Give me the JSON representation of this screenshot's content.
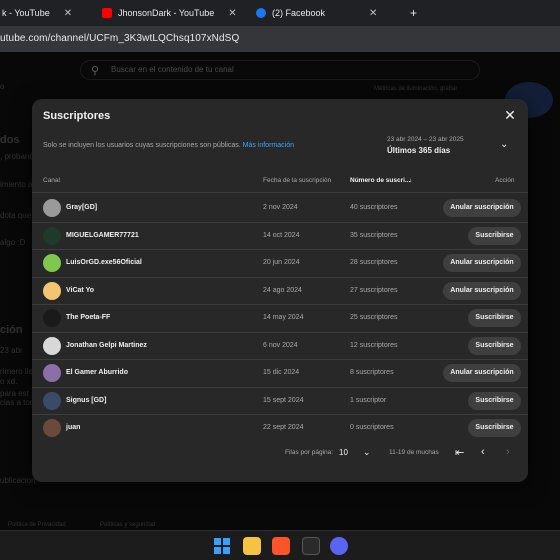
{
  "browser": {
    "tabs": [
      {
        "title": "k - YouTube"
      },
      {
        "title": "JhonsonDark - YouTube"
      },
      {
        "title": "(2) Facebook"
      }
    ],
    "new_tab": "+",
    "url": "utube.com/channel/UCFm_3K3wtLQChsq107xNdSQ"
  },
  "youtube": {
    "search_placeholder": "Buscar en el contenido de tu canal",
    "bg_texts": {
      "left1": "o",
      "left2": "dos",
      "left3": ", probando",
      "left4": "imiento a",
      "left5": "dota que",
      "left6": "algo :D",
      "left7": "ción",
      "left8": "23 abr",
      "left9": "rimero lleg",
      "left10": "o xd.",
      "left11": "para est",
      "left12": "cias a tod",
      "left13": "ublicacion",
      "right1": "Métricas de iluminación, grabar",
      "footer1": "Política de Privacidad",
      "footer2": "Políticas y seguridad"
    }
  },
  "dialog": {
    "title": "Suscriptores",
    "close_icon": "close-icon",
    "note": "Solo se incluyen los usuarios cuyas suscripciones son públicas.",
    "note_link": "Más información",
    "date_range": "23 abr 2024 – 23 abr 2025",
    "date_label": "Últimos 365 días",
    "columns": {
      "channel": "Canal",
      "date": "Fecha de la suscripción",
      "subs": "Número de suscri...",
      "sort_arrow": "↓",
      "action": "Acción"
    },
    "rows": [
      {
        "name": "Gray[GD]",
        "date": "2 nov 2024",
        "subs": "40 suscriptores",
        "action": "Anular suscripción",
        "action_type": "unsub",
        "avatar_color": "#9a9a9a"
      },
      {
        "name": "MIGUELGAMER77721",
        "date": "14 oct 2024",
        "subs": "35 suscriptores",
        "action": "Suscribirse",
        "action_type": "sub",
        "avatar_color": "#1e3a2a"
      },
      {
        "name": "LuisOrGD.exe56Oficial",
        "date": "20 jun 2024",
        "subs": "28 suscriptores",
        "action": "Anular suscripción",
        "action_type": "unsub",
        "avatar_color": "#7ec850"
      },
      {
        "name": "ViCat Yo",
        "date": "24 ago 2024",
        "subs": "27 suscriptores",
        "action": "Anular suscripción",
        "action_type": "unsub",
        "avatar_color": "#f2c572"
      },
      {
        "name": "The Poeta-FF",
        "date": "14 may 2024",
        "subs": "25 suscriptores",
        "action": "Suscribirse",
        "action_type": "sub",
        "avatar_color": "#1a1a1a"
      },
      {
        "name": "Jonathan Gelpi Martinez",
        "date": "6 nov 2024",
        "subs": "12 suscriptores",
        "action": "Suscribirse",
        "action_type": "sub",
        "avatar_color": "#d8d8d8"
      },
      {
        "name": "El Gamer Aburrido",
        "date": "15 dic 2024",
        "subs": "8 suscriptores",
        "action": "Anular suscripción",
        "action_type": "unsub",
        "avatar_color": "#8a6fa8"
      },
      {
        "name": "Signus [GD]",
        "date": "15 sept 2024",
        "subs": "1 suscriptor",
        "action": "Suscribirse",
        "action_type": "sub",
        "avatar_color": "#3a4a6a"
      },
      {
        "name": "juan",
        "date": "22 sept 2024",
        "subs": "0 suscriptores",
        "action": "Suscribirse",
        "action_type": "sub",
        "avatar_color": "#6a4a3a"
      }
    ],
    "footer": {
      "rows_per_page_label": "Filas por página:",
      "rows_per_page_value": "10",
      "range": "11-19 de muchas"
    }
  },
  "colors": {
    "background": "#0f0f0f",
    "dialog": "#282828",
    "button": "#3f3f3f",
    "link": "#3ea6ff"
  }
}
